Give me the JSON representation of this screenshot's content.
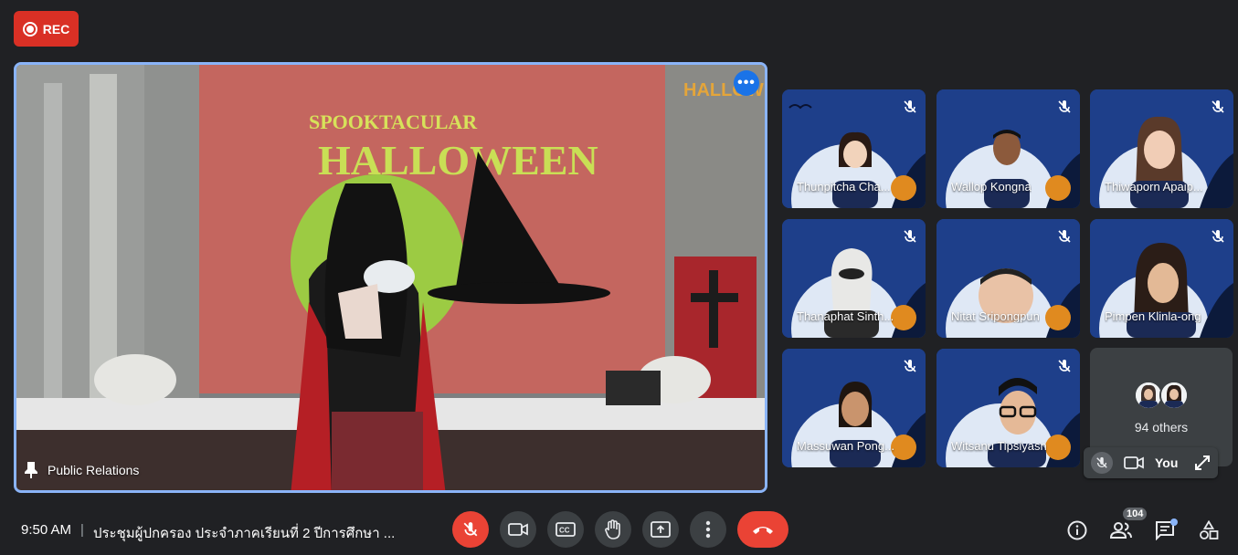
{
  "recording": {
    "label": "REC"
  },
  "main_tile": {
    "presenter_name": "Public Relations",
    "menu_glyph": "•••"
  },
  "participants": [
    {
      "name": "Thunpitcha Cha..."
    },
    {
      "name": "Wallop Kongna"
    },
    {
      "name": "Thiwaporn Apaip..."
    },
    {
      "name": "Thanaphat Sinth..."
    },
    {
      "name": "Nitat Sripongpun"
    },
    {
      "name": "Pimpen Klinla-ong"
    },
    {
      "name": "Massuwan Pong..."
    },
    {
      "name": "Witsanu Tipsiyasn"
    }
  ],
  "others": {
    "label": "94 others"
  },
  "self_tile": {
    "name": "You"
  },
  "meeting": {
    "time": "9:50 AM",
    "separator": "|",
    "title": "ประชุมผู้ปกครอง ประจำภาคเรียนที่ 2 ปีการศึกษา ..."
  },
  "people_count": "104",
  "icons": {
    "rec": "record-icon",
    "mic_off": "mic-off-icon",
    "camera": "camera-icon",
    "captions": "captions-icon",
    "raise_hand": "hand-icon",
    "present": "present-screen-icon",
    "more": "more-vert-icon",
    "end_call": "phone-hangup-icon",
    "info": "info-icon",
    "people": "people-icon",
    "chat": "chat-icon",
    "activities": "activities-icon",
    "pin": "pin-icon",
    "expand": "expand-icon"
  },
  "colors": {
    "background": "#202124",
    "tile_border_active": "#8ab4f8",
    "danger": "#ea4335",
    "control_bg": "#3c4043",
    "tile_theme": "#1e3f8a"
  }
}
